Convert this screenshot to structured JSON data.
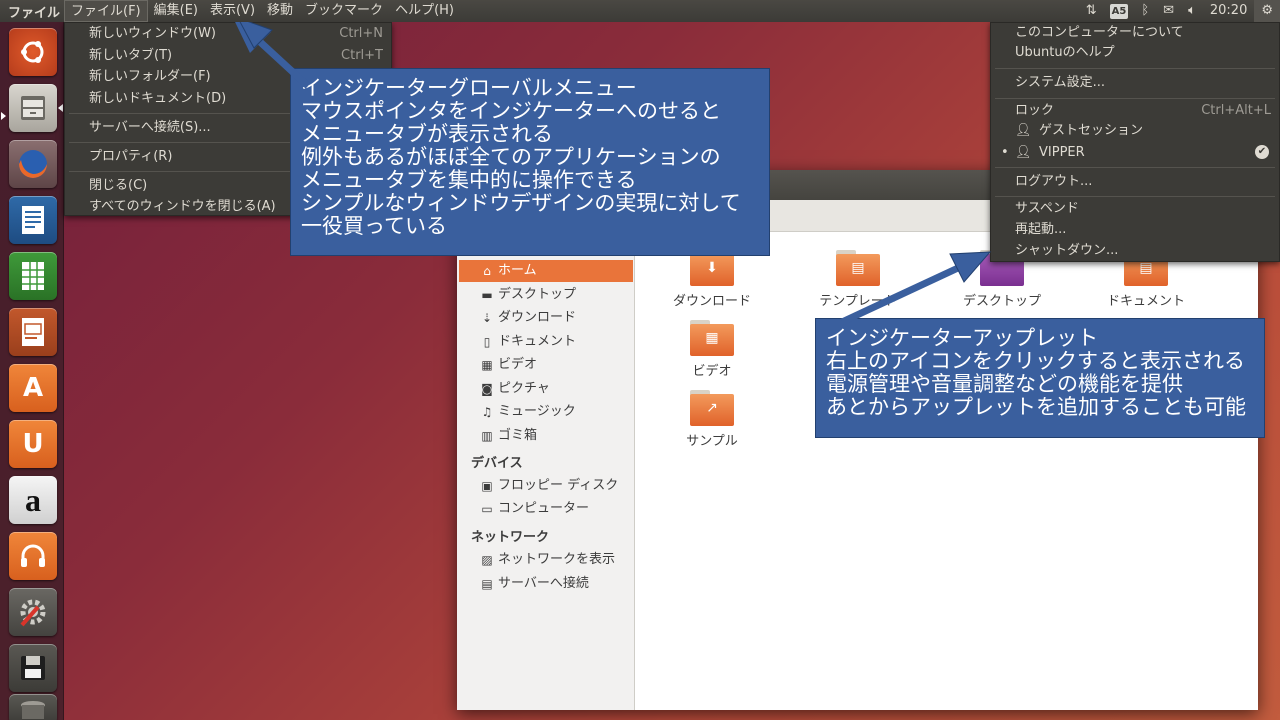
{
  "top_panel": {
    "app_title": "ファイル",
    "menus": [
      "ファイル(F)",
      "編集(E)",
      "表示(V)",
      "移動",
      "ブックマーク",
      "ヘルプ(H)"
    ],
    "keyboard_indicator": "A5",
    "clock": "20:20"
  },
  "launcher": {
    "items": [
      "ubuntu-dash-icon",
      "files-icon",
      "firefox-icon",
      "writer-icon",
      "calc-icon",
      "impress-icon",
      "software-center-icon",
      "ubuntu-one-icon",
      "amazon-icon",
      "ubuntu-one-music-icon",
      "system-settings-icon",
      "floppy-icon",
      "trash-icon"
    ],
    "amazon_glyph": "a",
    "u_glyph": "U",
    "a_glyph": "A"
  },
  "file_menu": {
    "items": [
      {
        "label": "新しいウィンドウ(W)",
        "accel": "Ctrl+N"
      },
      {
        "label": "新しいタブ(T)",
        "accel": "Ctrl+T"
      },
      {
        "label": "新しいフォルダー(F)",
        "accel": ""
      },
      {
        "label": "新しいドキュメント(D)",
        "accel": ""
      },
      {
        "label": "サーバーへ接続(S)...",
        "accel": ""
      },
      {
        "label": "プロパティ(R)",
        "accel": ""
      },
      {
        "label": "閉じる(C)",
        "accel": ""
      },
      {
        "label": "すべてのウィンドウを閉じる(A)",
        "accel": ""
      }
    ]
  },
  "system_menu": {
    "about": "このコンピューターについて",
    "help": "Ubuntuのヘルプ",
    "settings": "システム設定...",
    "lock": "ロック",
    "lock_accel": "Ctrl+Alt+L",
    "guest": "ゲストセッション",
    "user": "VIPPER",
    "logout": "ログアウト...",
    "suspend": "サスペンド",
    "restart": "再起動...",
    "shutdown": "シャットダウン..."
  },
  "sidebar": {
    "places": [
      {
        "label": "ホーム",
        "icon": "home-icon"
      },
      {
        "label": "デスクトップ",
        "icon": "desktop-icon"
      },
      {
        "label": "ダウンロード",
        "icon": "download-icon"
      },
      {
        "label": "ドキュメント",
        "icon": "document-icon"
      },
      {
        "label": "ビデオ",
        "icon": "video-icon"
      },
      {
        "label": "ピクチャ",
        "icon": "camera-icon"
      },
      {
        "label": "ミュージック",
        "icon": "music-icon"
      },
      {
        "label": "ゴミ箱",
        "icon": "trash-icon"
      }
    ],
    "devices_header": "デバイス",
    "devices": [
      {
        "label": "フロッピー ディスク",
        "icon": "floppy-icon"
      },
      {
        "label": "コンピューター",
        "icon": "computer-icon"
      }
    ],
    "network_header": "ネットワーク",
    "network": [
      {
        "label": "ネットワークを表示",
        "icon": "network-icon"
      },
      {
        "label": "サーバーへ接続",
        "icon": "server-icon"
      }
    ]
  },
  "folders": [
    {
      "label": "ダウンロード",
      "glyph": "⬇"
    },
    {
      "label": "テンプレート",
      "glyph": "▤"
    },
    {
      "label": "デスクトップ",
      "glyph": ""
    },
    {
      "label": "ドキュメント",
      "glyph": "▤"
    },
    {
      "label": "ビデオ",
      "glyph": "▦"
    },
    {
      "label": "サンプル",
      "glyph": "↗"
    }
  ],
  "callouts": {
    "menu": [
      "インジケーターグローバルメニュー",
      "マウスポインタをインジケーターへのせると",
      "メニュータブが表示される",
      "例外もあるがほぼ全てのアプリケーションの",
      "メニュータブを集中的に操作できる",
      "シンプルなウィンドウデザインの実現に対して",
      "一役買っている"
    ],
    "applet": [
      "インジケーターアップレット",
      "右上のアイコンをクリックすると表示される",
      "電源管理や音量調整などの機能を提供",
      "あとからアップレットを追加することも可能"
    ]
  },
  "colors": {
    "panel": "#3c3b37",
    "accent": "#e9743a",
    "callout": "#3a5f9e"
  }
}
